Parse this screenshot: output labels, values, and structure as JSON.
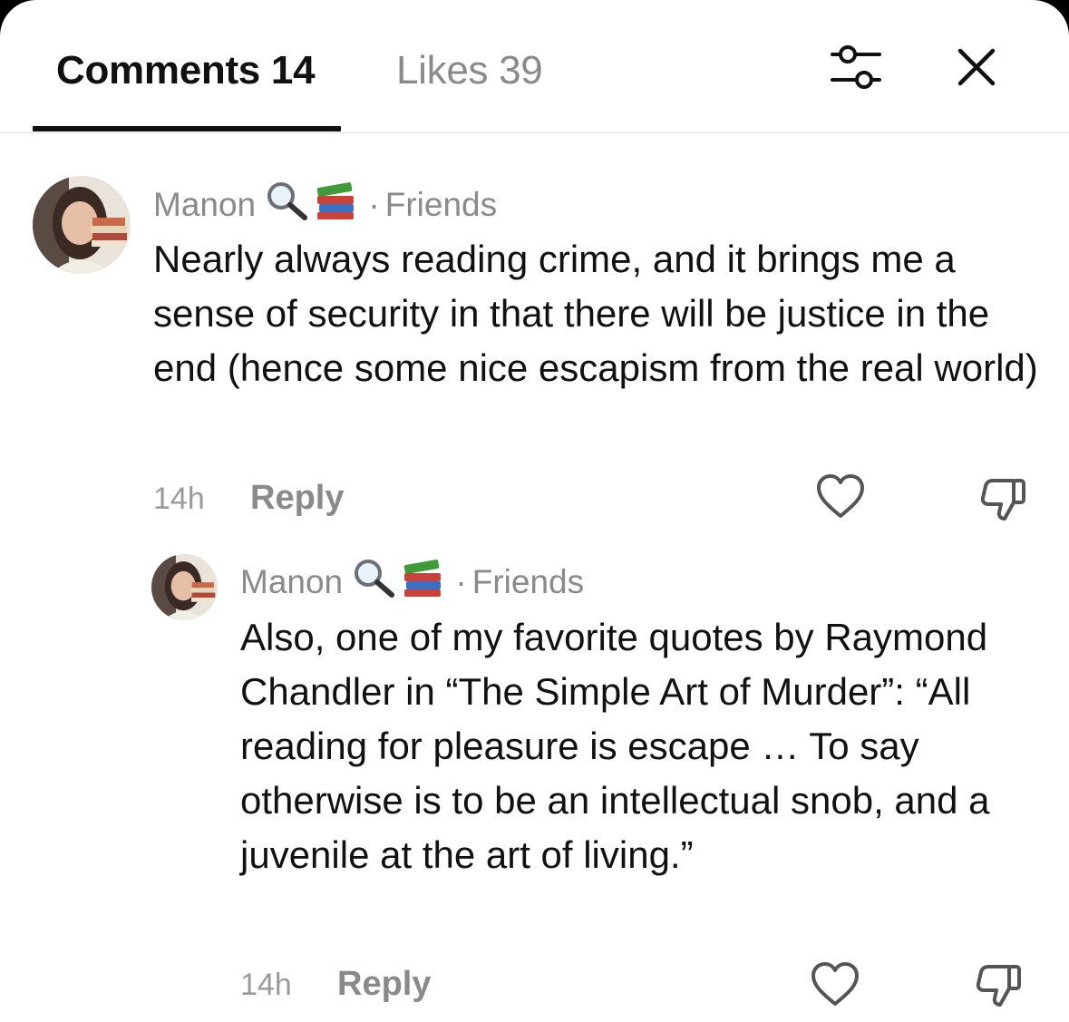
{
  "tabs": {
    "comments_label": "Comments 14",
    "likes_label": "Likes 39"
  },
  "icons": {
    "filter": "sliders-icon",
    "close": "close-icon",
    "like": "heart-icon",
    "dislike": "thumbs-down-icon"
  },
  "comments": [
    {
      "author": "Manon",
      "author_emojis": [
        "magnifying-glass-emoji",
        "books-emoji"
      ],
      "relation": "Friends",
      "text": "Nearly always reading crime, and it brings me a sense of security in that there will be justice in the end (hence some nice escapism from the real world)",
      "time": "14h",
      "reply_label": "Reply"
    },
    {
      "author": "Manon",
      "author_emojis": [
        "magnifying-glass-emoji",
        "books-emoji"
      ],
      "relation": "Friends",
      "text": "Also, one of my favorite quotes by Raymond Chandler in “The Simple Art of Murder”: “All reading for pleasure is escape … To say otherwise is to be an intellectual snob, and a juvenile at the art of living.”",
      "time": "14h",
      "reply_label": "Reply"
    }
  ]
}
